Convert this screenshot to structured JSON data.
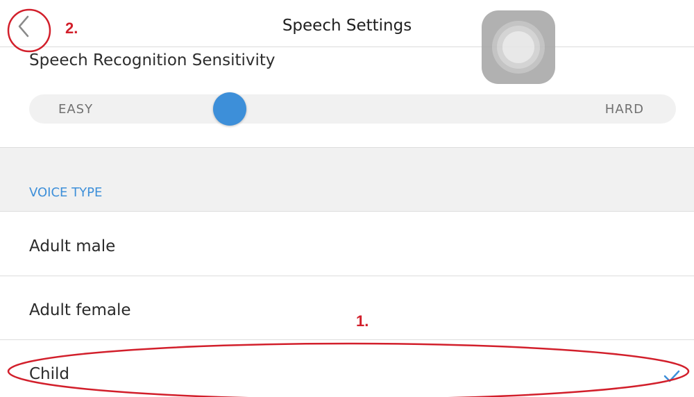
{
  "nav": {
    "title": "Speech Settings"
  },
  "sensitivity": {
    "title": "Speech Recognition Sensitivity",
    "min_label": "EASY",
    "max_label": "HARD",
    "value_fraction": 0.31
  },
  "voice_type": {
    "header": "VOICE TYPE",
    "options": [
      {
        "label": "Adult male",
        "selected": false
      },
      {
        "label": "Adult female",
        "selected": false
      },
      {
        "label": "Child",
        "selected": true
      }
    ]
  },
  "annotations": {
    "marker_1": "1.",
    "marker_2": "2."
  },
  "colors": {
    "accent": "#3d8fd9",
    "annotation": "#d21f2b",
    "divider": "#dcdcdc",
    "group_background": "#f1f1f1"
  },
  "icons": {
    "back": "chevron-left-icon",
    "selected": "checkmark-icon",
    "assistive_touch": "assistive-touch-icon"
  }
}
